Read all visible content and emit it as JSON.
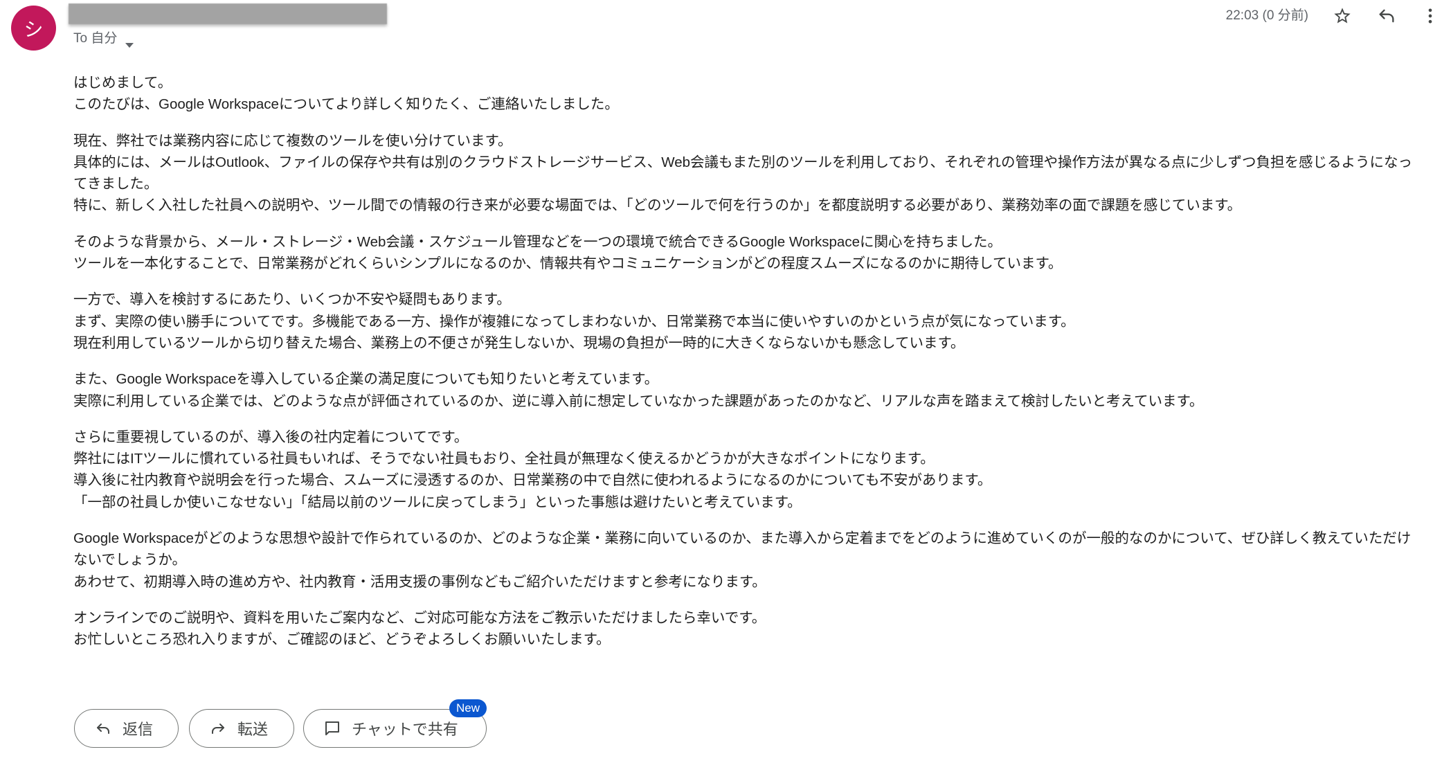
{
  "sender": {
    "avatar_initial": "シ",
    "avatar_color": "#c2185b",
    "recipient_label": "To 自分"
  },
  "header": {
    "timestamp": "22:03 (0 分前)"
  },
  "icons": {
    "star": "star-outline-icon",
    "reply": "reply-icon",
    "more": "more-vert-icon",
    "recipient_caret": "caret-down-icon",
    "forward": "forward-icon",
    "chat": "chat-bubble-icon"
  },
  "body": {
    "paragraphs": [
      {
        "lines": [
          "はじめまして。",
          "このたびは、Google Workspaceについてより詳しく知りたく、ご連絡いたしました。"
        ]
      },
      {
        "lines": [
          "現在、弊社では業務内容に応じて複数のツールを使い分けています。",
          "具体的には、メールはOutlook、ファイルの保存や共有は別のクラウドストレージサービス、Web会議もまた別のツールを利用しており、それぞれの管理や操作方法が異なる点に少しずつ負担を感じるようになっ",
          "てきました。",
          "特に、新しく入社した社員への説明や、ツール間での情報の行き来が必要な場面では、「どのツールで何を行うのか」を都度説明する必要があり、業務効率の面で課題を感じています。"
        ]
      },
      {
        "lines": [
          "そのような背景から、メール・ストレージ・Web会議・スケジュール管理などを一つの環境で統合できるGoogle Workspaceに関心を持ちました。",
          "ツールを一本化することで、日常業務がどれくらいシンプルになるのか、情報共有やコミュニケーションがどの程度スムーズになるのかに期待しています。"
        ]
      },
      {
        "lines": [
          "一方で、導入を検討するにあたり、いくつか不安や疑問もあります。",
          "まず、実際の使い勝手についてです。多機能である一方、操作が複雑になってしまわないか、日常業務で本当に使いやすいのかという点が気になっています。",
          "現在利用しているツールから切り替えた場合、業務上の不便さが発生しないか、現場の負担が一時的に大きくならないかも懸念しています。"
        ]
      },
      {
        "lines": [
          "また、Google Workspaceを導入している企業の満足度についても知りたいと考えています。",
          "実際に利用している企業では、どのような点が評価されているのか、逆に導入前に想定していなかった課題があったのかなど、リアルな声を踏まえて検討したいと考えています。"
        ]
      },
      {
        "lines": [
          "さらに重要視しているのが、導入後の社内定着についてです。",
          "弊社にはITツールに慣れている社員もいれば、そうでない社員もおり、全社員が無理なく使えるかどうかが大きなポイントになります。",
          "導入後に社内教育や説明会を行った場合、スムーズに浸透するのか、日常業務の中で自然に使われるようになるのかについても不安があります。",
          "「一部の社員しか使いこなせない」「結局以前のツールに戻ってしまう」といった事態は避けたいと考えています。"
        ]
      },
      {
        "lines": [
          "Google Workspaceがどのような思想や設計で作られているのか、どのような企業・業務に向いているのか、また導入から定着までをどのように進めていくのが一般的なのかについて、ぜひ詳しく教えていただけ",
          "ないでしょうか。",
          "あわせて、初期導入時の進め方や、社内教育・活用支援の事例などもご紹介いただけますと参考になります。"
        ]
      },
      {
        "lines": [
          "オンラインでのご説明や、資料を用いたご案内など、ご対応可能な方法をご教示いただけましたら幸いです。",
          "お忙しいところ恐れ入りますが、ご確認のほど、どうぞよろしくお願いいたします。"
        ]
      }
    ]
  },
  "actions": {
    "reply_label": "返信",
    "forward_label": "転送",
    "share_chat_label": "チャットで共有",
    "new_badge": "New"
  },
  "colors": {
    "accent": "#0b57d0",
    "text": "#1f1f1f",
    "muted": "#5f6368",
    "button_border": "#747775"
  }
}
